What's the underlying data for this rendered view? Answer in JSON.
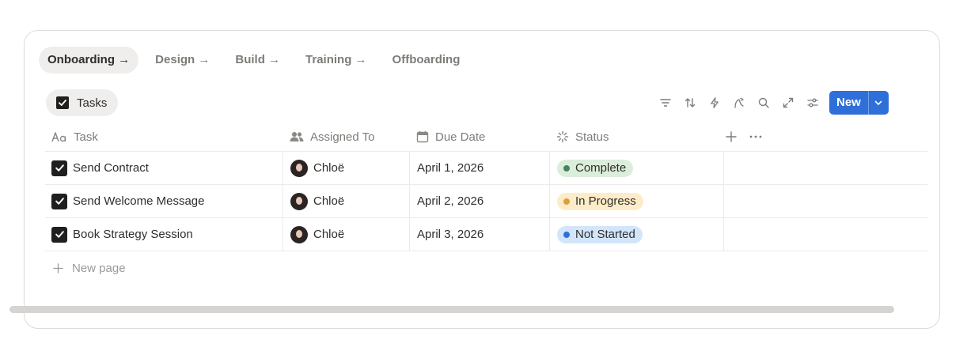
{
  "tabs": [
    {
      "label": "Onboarding →",
      "active": true
    },
    {
      "label": "Design →",
      "active": false
    },
    {
      "label": "Build →",
      "active": false
    },
    {
      "label": "Training →",
      "active": false
    },
    {
      "label": "Offboarding",
      "active": false
    }
  ],
  "view": {
    "label": "Tasks",
    "icon": "checkbox-icon"
  },
  "toolbar": {
    "tools": [
      "filter-icon",
      "sort-icon",
      "automation-icon",
      "ai-icon",
      "search-icon",
      "expand-icon",
      "settings-icon"
    ],
    "new_label": "New",
    "accent": "#2f6fd9"
  },
  "table": {
    "columns": [
      {
        "label": "Task",
        "icon": "text-property-icon"
      },
      {
        "label": "Assigned To",
        "icon": "people-icon"
      },
      {
        "label": "Due Date",
        "icon": "calendar-icon"
      },
      {
        "label": "Status",
        "icon": "status-icon"
      }
    ],
    "rows": [
      {
        "task": "Send Contract",
        "assignee": "Chloë",
        "due": "April 1, 2026",
        "status": "Complete"
      },
      {
        "task": "Send Welcome Message",
        "assignee": "Chloë",
        "due": "April 2, 2026",
        "status": "In Progress"
      },
      {
        "task": "Book Strategy Session",
        "assignee": "Chloë",
        "due": "April 3, 2026",
        "status": "Not Started"
      }
    ],
    "status_colors": {
      "Complete": {
        "bg": "#dbeddb",
        "dot": "#448361"
      },
      "In Progress": {
        "bg": "#fdecc8",
        "dot": "#d9a13b"
      },
      "Not Started": {
        "bg": "#d3e5fb",
        "dot": "#2f6fd9"
      }
    },
    "new_page_label": "New page"
  }
}
